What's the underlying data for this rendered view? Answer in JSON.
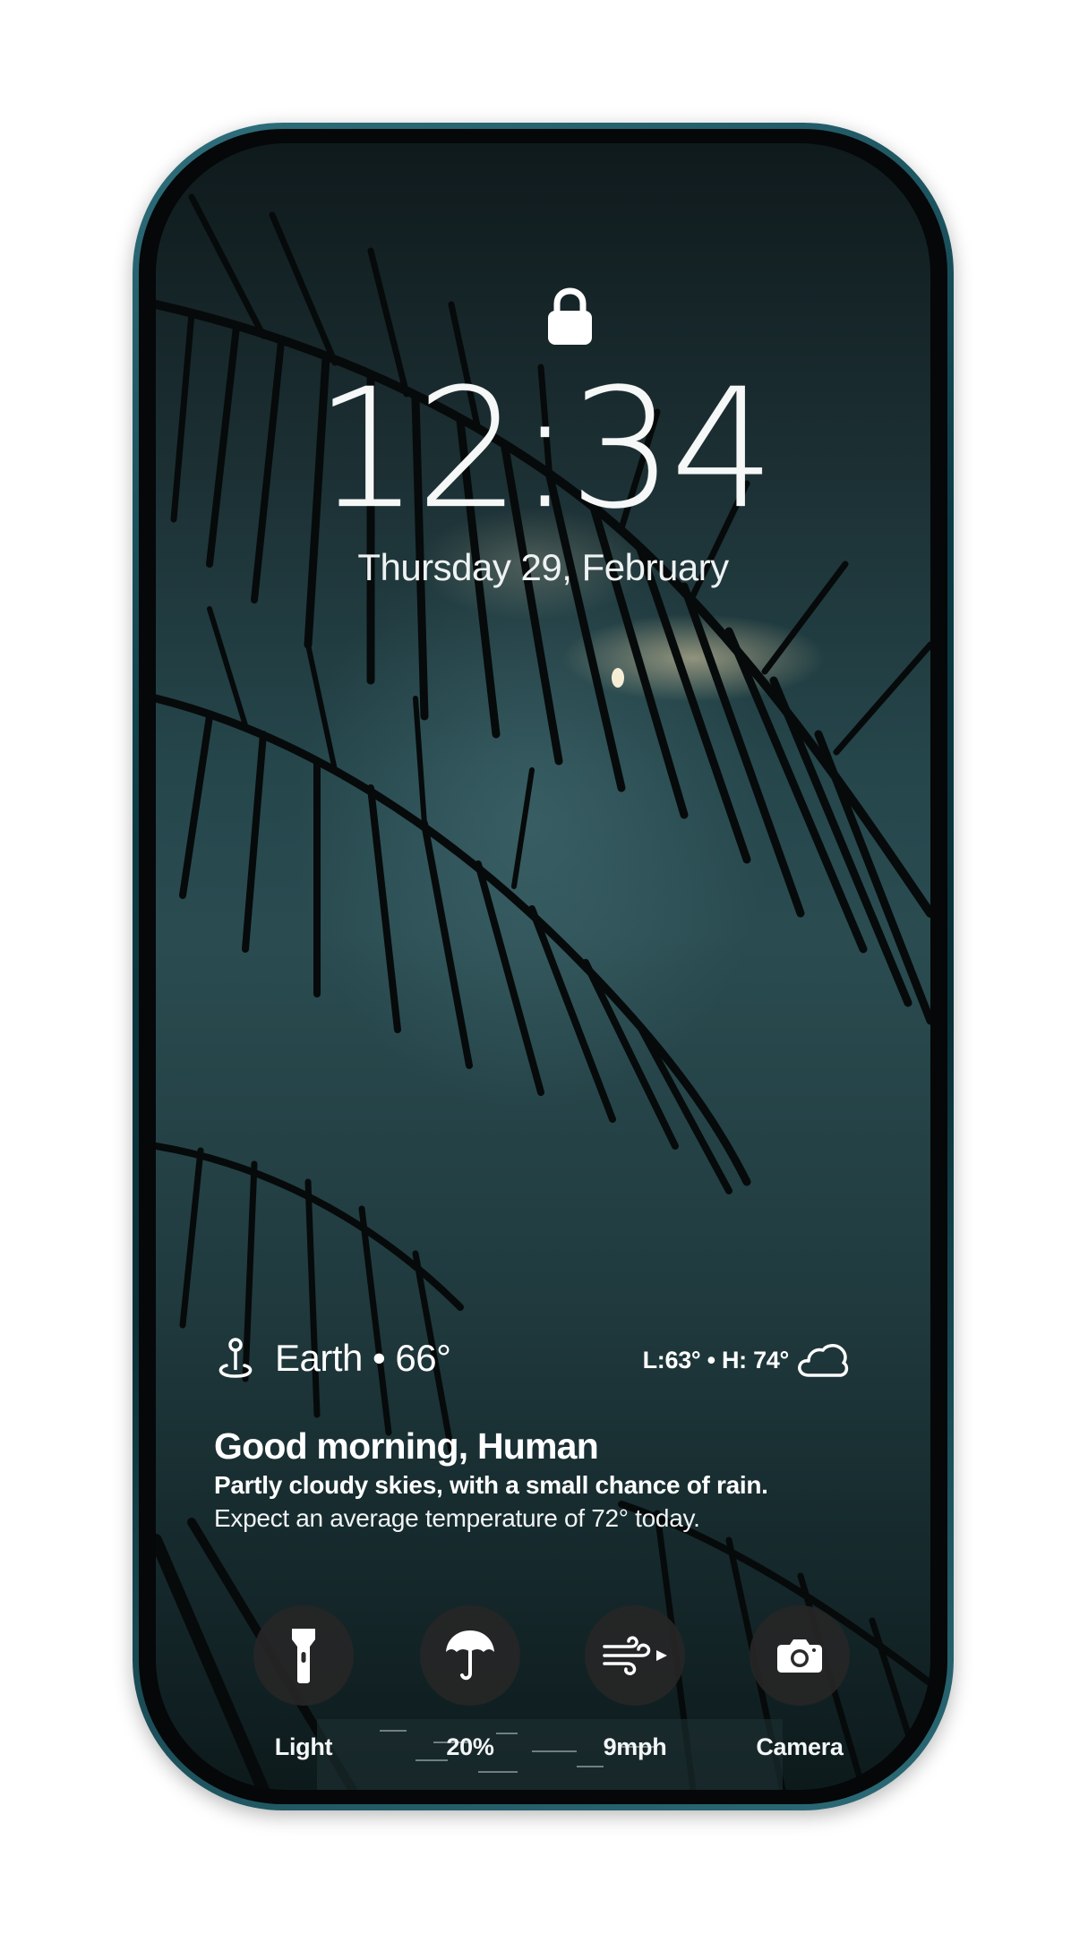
{
  "lockscreen": {
    "time": "12:34",
    "date": "Thursday 29, February"
  },
  "weather": {
    "location": "Earth • 66°",
    "range": "L:63° • H: 74°",
    "condition_icon": "cloud-icon",
    "location_icon": "map-pin-icon"
  },
  "greeting": {
    "title": "Good morning, Human",
    "forecast": "Partly cloudy skies, with a small chance of rain.",
    "detail": "Expect an average temperature of 72° today."
  },
  "quick_actions": [
    {
      "label": "Light",
      "icon": "flashlight-icon"
    },
    {
      "label": "20%",
      "icon": "umbrella-icon"
    },
    {
      "label": "9mph",
      "icon": "wind-icon"
    },
    {
      "label": "Camera",
      "icon": "camera-icon"
    }
  ],
  "colors": {
    "frame": "#0c3b45",
    "background": "#25464b",
    "button": "#262626",
    "text": "#ffffff"
  }
}
